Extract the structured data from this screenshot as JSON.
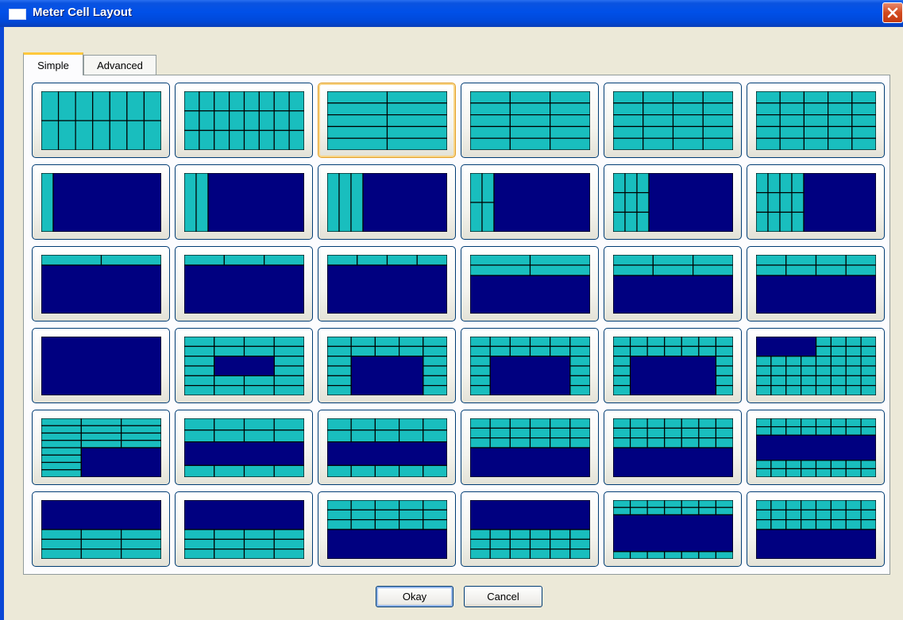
{
  "window": {
    "title": "Meter Cell Layout"
  },
  "tabs": [
    {
      "label": "Simple",
      "selected": true
    },
    {
      "label": "Advanced",
      "selected": false
    }
  ],
  "buttons": {
    "okay": "Okay",
    "cancel": "Cancel"
  },
  "colors": {
    "cell_fill": "#19bebe",
    "main_fill": "#000080",
    "grid_line": "#000000",
    "title_bar": "#0050e8"
  },
  "selected_layout_index": 2,
  "layouts": [
    [
      {
        "c": 7,
        "r": 2
      }
    ],
    [
      {
        "c": 8,
        "r": 3
      }
    ],
    [
      {
        "c": 2,
        "r": 5
      }
    ],
    [
      {
        "c": 3,
        "r": 5
      }
    ],
    [
      {
        "c": 4,
        "r": 5
      }
    ],
    [
      {
        "c": 5,
        "r": 5
      }
    ],
    [
      {
        "c": 1,
        "r": 1,
        "w": 1
      },
      {
        "main": true
      }
    ],
    [
      {
        "c": 2,
        "r": 1,
        "w": 1
      },
      {
        "main": true
      }
    ],
    [
      {
        "c": 3,
        "r": 1,
        "w": 1
      },
      {
        "main": true
      }
    ],
    [
      {
        "c": 2,
        "r": 2,
        "w": 1
      },
      {
        "main": true
      }
    ],
    [
      {
        "c": 3,
        "r": 3,
        "w": 1
      },
      {
        "main": true
      }
    ],
    [
      {
        "c": 4,
        "r": 3,
        "w": 1
      },
      {
        "main": true
      }
    ],
    [
      {
        "c": 2,
        "r": 1,
        "h": 1
      },
      {
        "main": true
      }
    ],
    [
      {
        "c": 3,
        "r": 1,
        "h": 1
      },
      {
        "main": true
      }
    ],
    [
      {
        "c": 4,
        "r": 1,
        "h": 1
      },
      {
        "main": true
      }
    ],
    [
      {
        "c": 2,
        "r": 2,
        "h": 1
      },
      {
        "main": true
      }
    ],
    [
      {
        "c": 3,
        "r": 2,
        "h": 1
      },
      {
        "main": true
      }
    ],
    [
      {
        "c": 4,
        "r": 2,
        "h": 1
      },
      {
        "main": true
      }
    ],
    [
      {
        "main": true
      }
    ],
    [
      {
        "c": 4,
        "r": 6
      },
      {
        "frame": [
          1,
          2,
          3,
          4
        ]
      }
    ],
    [
      {
        "c": 5,
        "r": 6
      },
      {
        "frame": [
          1,
          2,
          4,
          6
        ]
      }
    ],
    [
      {
        "c": 6,
        "r": 6
      },
      {
        "frame": [
          1,
          2,
          5,
          6
        ]
      }
    ],
    [
      {
        "c": 7,
        "r": 6
      },
      {
        "frame": [
          1,
          2,
          6,
          6
        ]
      }
    ],
    [
      {
        "c": 8,
        "r": 6
      },
      {
        "frame": [
          0,
          0,
          4,
          2
        ]
      }
    ],
    [
      {
        "c": 3,
        "r": 8
      },
      {
        "frame": [
          1,
          4,
          3,
          8
        ]
      }
    ],
    [
      {
        "c": 4,
        "r": 5
      },
      {
        "frame": [
          0,
          2,
          4,
          4
        ]
      }
    ],
    [
      {
        "c": 5,
        "r": 5
      },
      {
        "frame": [
          0,
          2,
          5,
          4
        ]
      }
    ],
    [
      {
        "c": 6,
        "r": 6
      },
      {
        "frame": [
          0,
          3,
          6,
          6
        ]
      }
    ],
    [
      {
        "c": 7,
        "r": 6
      },
      {
        "frame": [
          0,
          3,
          7,
          6
        ]
      }
    ],
    [
      {
        "c": 8,
        "r": 7
      },
      {
        "frame": [
          0,
          2,
          8,
          5
        ]
      }
    ],
    [
      {
        "c": 3,
        "r": 6
      },
      {
        "frame": [
          0,
          0,
          3,
          3
        ]
      }
    ],
    [
      {
        "c": 4,
        "r": 6
      },
      {
        "frame": [
          0,
          0,
          4,
          3
        ]
      }
    ],
    [
      {
        "c": 5,
        "r": 6
      },
      {
        "frame": [
          0,
          3,
          5,
          6
        ]
      }
    ],
    [
      {
        "c": 6,
        "r": 6
      },
      {
        "frame": [
          0,
          0,
          6,
          3
        ]
      }
    ],
    [
      {
        "c": 7,
        "r": 8
      },
      {
        "frame": [
          0,
          2,
          7,
          7
        ]
      }
    ],
    [
      {
        "c": 8,
        "r": 6
      },
      {
        "frame": [
          0,
          3,
          8,
          6
        ]
      }
    ]
  ]
}
